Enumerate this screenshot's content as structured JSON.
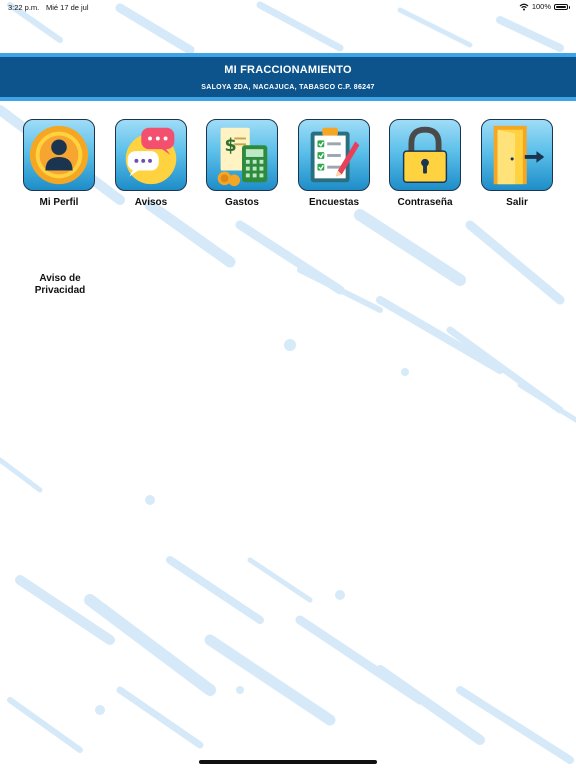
{
  "status_bar": {
    "time": "3:22 p.m.",
    "date": "Mié 17 de jul",
    "battery": "100%"
  },
  "header": {
    "title": "MI FRACCIONAMIENTO",
    "subtitle": "SALOYA 2DA, NACAJUCA, TABASCO C.P. 86247"
  },
  "menu": [
    {
      "label": "Mi Perfil",
      "icon": "user-profile-icon"
    },
    {
      "label": "Avisos",
      "icon": "chat-bubbles-icon"
    },
    {
      "label": "Gastos",
      "icon": "receipt-calculator-icon"
    },
    {
      "label": "Encuestas",
      "icon": "clipboard-checklist-icon"
    },
    {
      "label": "Contraseña",
      "icon": "padlock-icon"
    },
    {
      "label": "Salir",
      "icon": "exit-door-icon"
    }
  ],
  "privacy_link": "Aviso de Privacidad",
  "colors": {
    "header": "#0d548c",
    "header_border": "#3fa4e6",
    "tile_gradient_top": "#9fdcf7",
    "tile_gradient_bottom": "#1e8dc8"
  }
}
